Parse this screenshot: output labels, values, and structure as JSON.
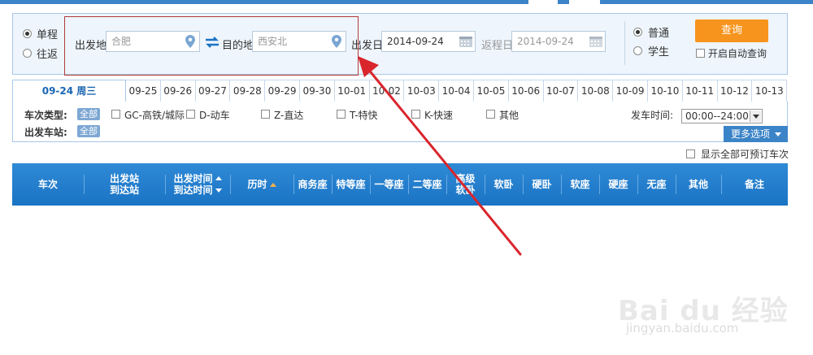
{
  "trip_type": {
    "one_way": "单程",
    "round_trip": "往返",
    "selected": "单程"
  },
  "from": {
    "label": "出发地",
    "value": "合肥"
  },
  "to": {
    "label": "目的地",
    "value": "西安北"
  },
  "depart_date": {
    "label": "出发日",
    "value": "2014-09-24"
  },
  "return_date": {
    "label": "返程日",
    "value": "2014-09-24"
  },
  "passenger_type": {
    "normal": "普通",
    "student": "学生",
    "selected": "普通"
  },
  "query_button": "查询",
  "auto_query_label": "开启自动查询",
  "date_tabs": {
    "active": "09-24 周三",
    "dates": [
      "09-25",
      "09-26",
      "09-27",
      "09-28",
      "09-29",
      "09-30",
      "10-01",
      "10-02",
      "10-03",
      "10-04",
      "10-05",
      "10-06",
      "10-07",
      "10-08",
      "10-09",
      "10-10",
      "10-11",
      "10-12",
      "10-13"
    ]
  },
  "filters": {
    "train_type_label": "车次类型:",
    "all_tag": "全部",
    "types": [
      "GC-高铁/城际",
      "D-动车",
      "Z-直达",
      "T-特快",
      "K-快速",
      "其他"
    ],
    "depart_station_label": "出发车站:",
    "depart_station_tag": "全部",
    "depart_time_label": "发车时间:",
    "depart_time_value": "00:00--24:00",
    "more_options": "更多选项"
  },
  "show_all_bookable": "显示全部可预订车次",
  "table_headers": {
    "train_no": "车次",
    "station_from": "出发站",
    "station_to": "到达站",
    "time_depart": "出发时间",
    "time_arrive": "到达时间",
    "duration": "历时",
    "business": "商务座",
    "special": "特等座",
    "first": "一等座",
    "second": "二等座",
    "adv_soft_1": "高级",
    "adv_soft_2": "软卧",
    "soft_sleeper": "软卧",
    "hard_sleeper": "硬卧",
    "soft_seat": "软座",
    "hard_seat": "硬座",
    "no_seat": "无座",
    "other": "其他",
    "remark": "备注"
  },
  "watermark": {
    "brand": "Bai du 经验",
    "url": "jingyan.baidu.com"
  },
  "colors": {
    "accent": "#1a73c4",
    "query": "#f7941d",
    "annotation": "#d9262c"
  }
}
